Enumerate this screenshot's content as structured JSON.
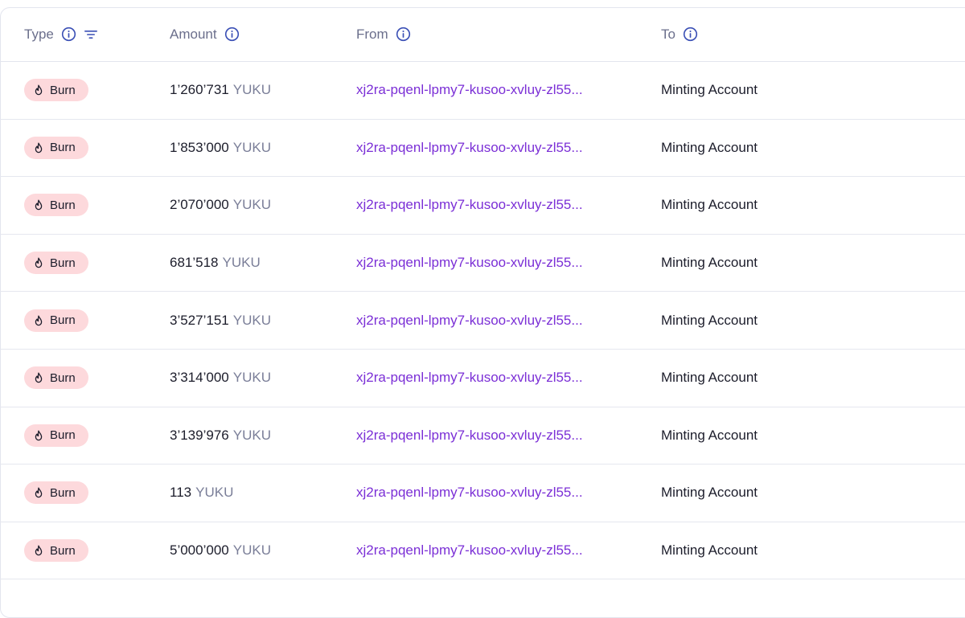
{
  "colors": {
    "header_text": "#6b6f8c",
    "icon_accent": "#3a4fb5",
    "badge_bg": "#fdd9dc",
    "link": "#7b2fd6",
    "text": "#1c1d2b",
    "unit": "#7a7e98"
  },
  "table": {
    "columns": [
      {
        "key": "type",
        "label": "Type",
        "icon": "info-icon",
        "filter_icon": "filter-icon"
      },
      {
        "key": "amount",
        "label": "Amount",
        "icon": "info-icon"
      },
      {
        "key": "from",
        "label": "From",
        "icon": "info-icon"
      },
      {
        "key": "to",
        "label": "To",
        "icon": "info-icon"
      }
    ],
    "rows": [
      {
        "type": "Burn",
        "type_icon": "flame-icon",
        "amount": "1’260’731",
        "unit": "YUKU",
        "from": "xj2ra-pqenl-lpmy7-kusoo-xvluy-zl55...",
        "to": "Minting Account"
      },
      {
        "type": "Burn",
        "type_icon": "flame-icon",
        "amount": "1’853’000",
        "unit": "YUKU",
        "from": "xj2ra-pqenl-lpmy7-kusoo-xvluy-zl55...",
        "to": "Minting Account"
      },
      {
        "type": "Burn",
        "type_icon": "flame-icon",
        "amount": "2’070’000",
        "unit": "YUKU",
        "from": "xj2ra-pqenl-lpmy7-kusoo-xvluy-zl55...",
        "to": "Minting Account"
      },
      {
        "type": "Burn",
        "type_icon": "flame-icon",
        "amount": "681’518",
        "unit": "YUKU",
        "from": "xj2ra-pqenl-lpmy7-kusoo-xvluy-zl55...",
        "to": "Minting Account"
      },
      {
        "type": "Burn",
        "type_icon": "flame-icon",
        "amount": "3’527’151",
        "unit": "YUKU",
        "from": "xj2ra-pqenl-lpmy7-kusoo-xvluy-zl55...",
        "to": "Minting Account"
      },
      {
        "type": "Burn",
        "type_icon": "flame-icon",
        "amount": "3’314’000",
        "unit": "YUKU",
        "from": "xj2ra-pqenl-lpmy7-kusoo-xvluy-zl55...",
        "to": "Minting Account"
      },
      {
        "type": "Burn",
        "type_icon": "flame-icon",
        "amount": "3’139’976",
        "unit": "YUKU",
        "from": "xj2ra-pqenl-lpmy7-kusoo-xvluy-zl55...",
        "to": "Minting Account"
      },
      {
        "type": "Burn",
        "type_icon": "flame-icon",
        "amount": "113",
        "unit": "YUKU",
        "from": "xj2ra-pqenl-lpmy7-kusoo-xvluy-zl55...",
        "to": "Minting Account"
      },
      {
        "type": "Burn",
        "type_icon": "flame-icon",
        "amount": "5’000’000",
        "unit": "YUKU",
        "from": "xj2ra-pqenl-lpmy7-kusoo-xvluy-zl55...",
        "to": "Minting Account"
      }
    ]
  }
}
